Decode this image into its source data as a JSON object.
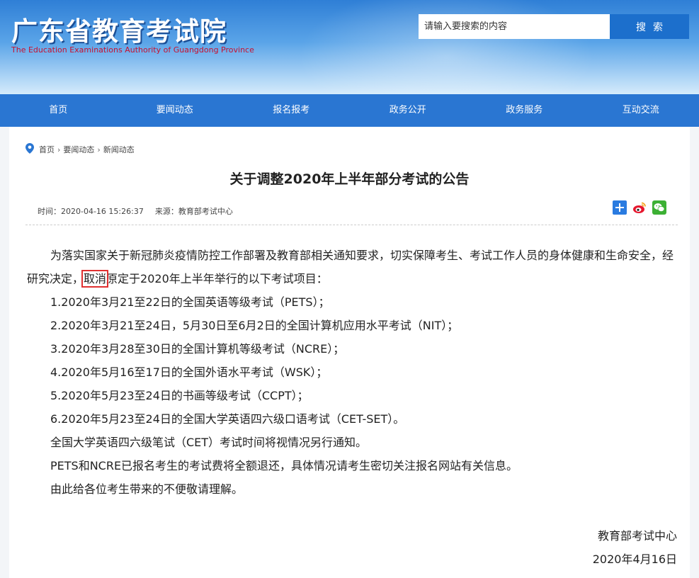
{
  "header": {
    "logo_cn": "广东省教育考试院",
    "logo_en": "The Education Examinations Authority of Guangdong Province",
    "search_placeholder": "请输入要搜索的内容",
    "search_button": "搜索"
  },
  "nav": [
    "首页",
    "要闻动态",
    "报名报考",
    "政务公开",
    "政务服务",
    "互动交流"
  ],
  "breadcrumb": [
    "首页",
    "要闻动态",
    "新闻动态"
  ],
  "article": {
    "title": "关于调整2020年上半年部分考试的公告",
    "time": "时间：2020-04-16 15:26:37",
    "source": "来源：教育部考试中心",
    "p1_before": "为落实国家关于新冠肺炎疫情防控工作部署及教育部相关通知要求，切实保障考生、考试工作人员的身体健康和生命安全，经研究决定，",
    "p1_highlight": "取消",
    "p1_after": "原定于2020年上半年举行的以下考试项目：",
    "items": [
      "1.2020年3月21至22日的全国英语等级考试（PETS）；",
      "2.2020年3月21至24日，5月30日至6月2日的全国计算机应用水平考试（NIT）；",
      "3.2020年3月28至30日的全国计算机等级考试（NCRE）；",
      "4.2020年5月16至17日的全国外语水平考试（WSK）；",
      "5.2020年5月23至24日的书画等级考试（CCPT）；",
      "6.2020年5月23至24日的全国大学英语四六级口语考试（CET-SET）。"
    ],
    "notes": [
      "全国大学英语四六级笔试（CET）考试时间将视情况另行通知。",
      "PETS和NCRE已报名考生的考试费将全额退还，具体情况请考生密切关注报名网站有关信息。",
      "由此给各位考生带来的不便敬请理解。"
    ],
    "signature": "教育部考试中心",
    "date": "2020年4月16日"
  },
  "share": [
    "share-plus-icon",
    "weibo-icon",
    "wechat-icon"
  ],
  "colors": {
    "nav_bg": "#2a76d2",
    "search_btn": "#1c6fcc",
    "highlight_box": "#e03030",
    "logo_en": "#c8102e"
  }
}
